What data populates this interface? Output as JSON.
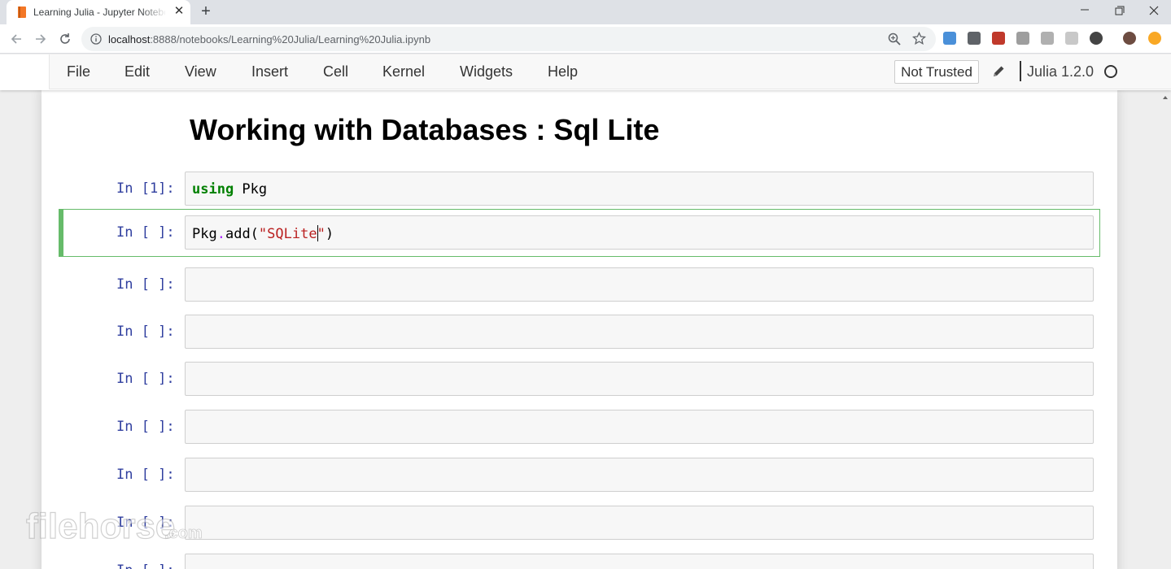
{
  "browser": {
    "tab_title": "Learning Julia - Jupyter Notebook",
    "url_host": "localhost",
    "url_path": ":8888/notebooks/Learning%20Julia/Learning%20Julia.ipynb"
  },
  "jupyter": {
    "menu": [
      "File",
      "Edit",
      "View",
      "Insert",
      "Cell",
      "Kernel",
      "Widgets",
      "Help"
    ],
    "trust_label": "Not Trusted",
    "kernel_name": "Julia 1.2.0",
    "title": "Working with Databases : Sql Lite",
    "cells": [
      {
        "prompt": "In [1]:",
        "code": "using Pkg"
      },
      {
        "prompt": "In [ ]:",
        "code": "Pkg.add(\"SQLite\")"
      },
      {
        "prompt": "In [ ]:",
        "code": ""
      },
      {
        "prompt": "In [ ]:",
        "code": ""
      },
      {
        "prompt": "In [ ]:",
        "code": ""
      },
      {
        "prompt": "In [ ]:",
        "code": ""
      },
      {
        "prompt": "In [ ]:",
        "code": ""
      },
      {
        "prompt": "In [ ]:",
        "code": ""
      },
      {
        "prompt": "In [ ]:",
        "code": ""
      }
    ],
    "cell1_code": {
      "keyword": "using",
      "rest": " Pkg"
    },
    "cell2_code": {
      "p1": "Pkg",
      "p2": ".",
      "p3": "add(",
      "p4": "\"SQLite",
      "p5": "\"",
      "p6": ")"
    }
  },
  "watermark": "filehorse.com",
  "colors": {
    "prompt": "#303f9f",
    "selected_border": "#66bb6a",
    "keyword": "#008000",
    "string": "#ba2121"
  }
}
